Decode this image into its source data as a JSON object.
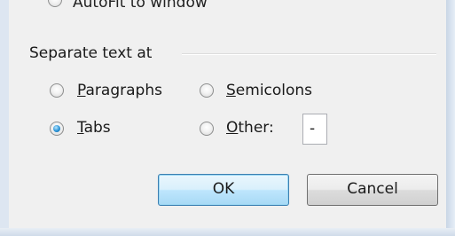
{
  "top_option": {
    "label_visible": "AutoFit to window"
  },
  "group": {
    "title": "Separate text at"
  },
  "options": {
    "paragraphs": {
      "label": "Paragraphs",
      "mnemonic": "P",
      "rest": "aragraphs",
      "checked": false
    },
    "semicolons": {
      "label": "Semicolons",
      "mnemonic": "S",
      "rest": "emicolons",
      "checked": false
    },
    "tabs": {
      "label": "Tabs",
      "mnemonic": "T",
      "rest": "abs",
      "checked": true
    },
    "other": {
      "label": "Other:",
      "mnemonic": "O",
      "rest": "ther:",
      "checked": false,
      "value": "-"
    }
  },
  "buttons": {
    "ok": "OK",
    "cancel": "Cancel"
  }
}
